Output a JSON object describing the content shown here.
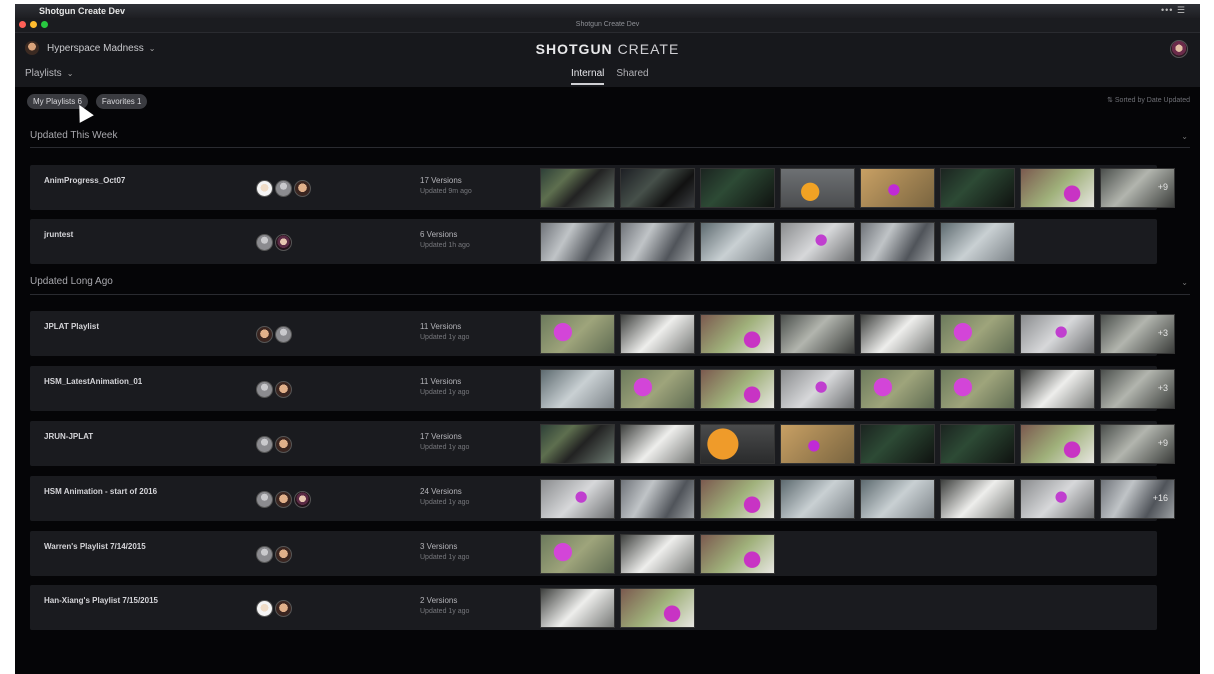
{
  "menubar": {
    "app_name": "Shotgun Create Dev",
    "right_icons": "••• ☰"
  },
  "window": {
    "title": "Shotgun Create Dev"
  },
  "header": {
    "project": "Hyperspace Madness",
    "logo_bold": "SHOTGUN",
    "logo_light": "CREATE",
    "playlists_label": "Playlists",
    "tabs": [
      {
        "label": "Internal",
        "active": true
      },
      {
        "label": "Shared",
        "active": false
      }
    ]
  },
  "filters": {
    "my_playlists": "My Playlists 6",
    "favorites": "Favorites 1",
    "sort_label": "⇅ Sorted by Date Updated"
  },
  "sections": [
    {
      "title": "Updated This Week",
      "rows": [
        {
          "name": "AnimProgress_Oct07",
          "versions": "17 Versions",
          "updated": "Updated 9m ago",
          "avatars": [
            "wht",
            "grey",
            "face"
          ],
          "thumbs": [
            "t1",
            "t2",
            "t6",
            "t4",
            "t5",
            "t6",
            "t7",
            "t8"
          ],
          "more": "+9"
        },
        {
          "name": "jruntest",
          "versions": "6 Versions",
          "updated": "Updated 1h ago",
          "avatars": [
            "grey",
            "dark"
          ],
          "thumbs": [
            "t3",
            "t3",
            "t9",
            "t10",
            "t3",
            "t9"
          ],
          "more": ""
        }
      ]
    },
    {
      "title": "Updated Long Ago",
      "rows": [
        {
          "name": "JPLAT Playlist",
          "versions": "11 Versions",
          "updated": "Updated 1y ago",
          "avatars": [
            "face",
            "grey"
          ],
          "thumbs": [
            "t12",
            "t13",
            "t7",
            "t8",
            "t13",
            "t12",
            "t10",
            "t8"
          ],
          "more": "+3"
        },
        {
          "name": "HSM_LatestAnimation_01",
          "versions": "11 Versions",
          "updated": "Updated 1y ago",
          "avatars": [
            "grey",
            "face"
          ],
          "thumbs": [
            "t9",
            "t12",
            "t7",
            "t10",
            "t12",
            "t12",
            "t13",
            "t8"
          ],
          "more": "+3"
        },
        {
          "name": "JRUN-JPLAT",
          "versions": "17 Versions",
          "updated": "Updated 1y ago",
          "avatars": [
            "grey",
            "face"
          ],
          "thumbs": [
            "t1",
            "t13",
            "t11",
            "t5",
            "t6",
            "t6",
            "t7",
            "t8"
          ],
          "more": "+9"
        },
        {
          "name": "HSM Animation - start of 2016",
          "versions": "24 Versions",
          "updated": "Updated 1y ago",
          "avatars": [
            "grey",
            "face",
            "dark"
          ],
          "thumbs": [
            "t10",
            "t3",
            "t7",
            "t9",
            "t9",
            "t13",
            "t10",
            "t3"
          ],
          "more": "+16"
        },
        {
          "name": "Warren's Playlist 7/14/2015",
          "versions": "3 Versions",
          "updated": "Updated 1y ago",
          "avatars": [
            "grey",
            "face"
          ],
          "thumbs": [
            "t12",
            "t13",
            "t7"
          ],
          "more": ""
        },
        {
          "name": "Han-Xiang's Playlist 7/15/2015",
          "versions": "2 Versions",
          "updated": "Updated 1y ago",
          "avatars": [
            "wht",
            "face"
          ],
          "thumbs": [
            "t13",
            "t7"
          ],
          "more": ""
        }
      ]
    }
  ]
}
